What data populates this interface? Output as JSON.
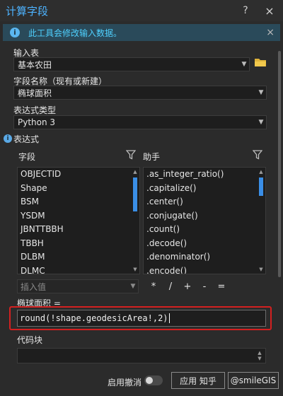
{
  "window": {
    "title": "计算字段",
    "help": "?",
    "close": "×"
  },
  "info": {
    "message": "此工具会修改输入数据。",
    "close": "×"
  },
  "input_table": {
    "label": "输入表",
    "value": "基本农田"
  },
  "field_name": {
    "label": "字段名称（现有或新建）",
    "value": "椭球面积"
  },
  "expression_type": {
    "label": "表达式类型",
    "value": "Python 3"
  },
  "expression": {
    "label": "表达式",
    "fields_header": "字段",
    "helpers_header": "助手",
    "fields": [
      "OBJECTID",
      "Shape",
      "BSM",
      "YSDM",
      "JBNTTBBH",
      "TBBH",
      "DLBM",
      "DLMC"
    ],
    "helpers": [
      ".as_integer_ratio()",
      ".capitalize()",
      ".center()",
      ".conjugate()",
      ".count()",
      ".decode()",
      ".denominator()",
      ".encode()"
    ],
    "insert_value": "插入值",
    "operators": [
      "*",
      "/",
      "+",
      "-",
      "="
    ],
    "target_label": "椭球面积 =",
    "value": "round(!shape.geodesicArea!,2)"
  },
  "code_block": {
    "label": "代码块"
  },
  "footer": {
    "undo_label": "启用撤消",
    "apply": "应用 知乎",
    "ok": "@smileGIS"
  },
  "colors": {
    "accent": "#4db3ff",
    "highlight": "#d42020",
    "scroll_thumb": "#3a8ee6"
  }
}
